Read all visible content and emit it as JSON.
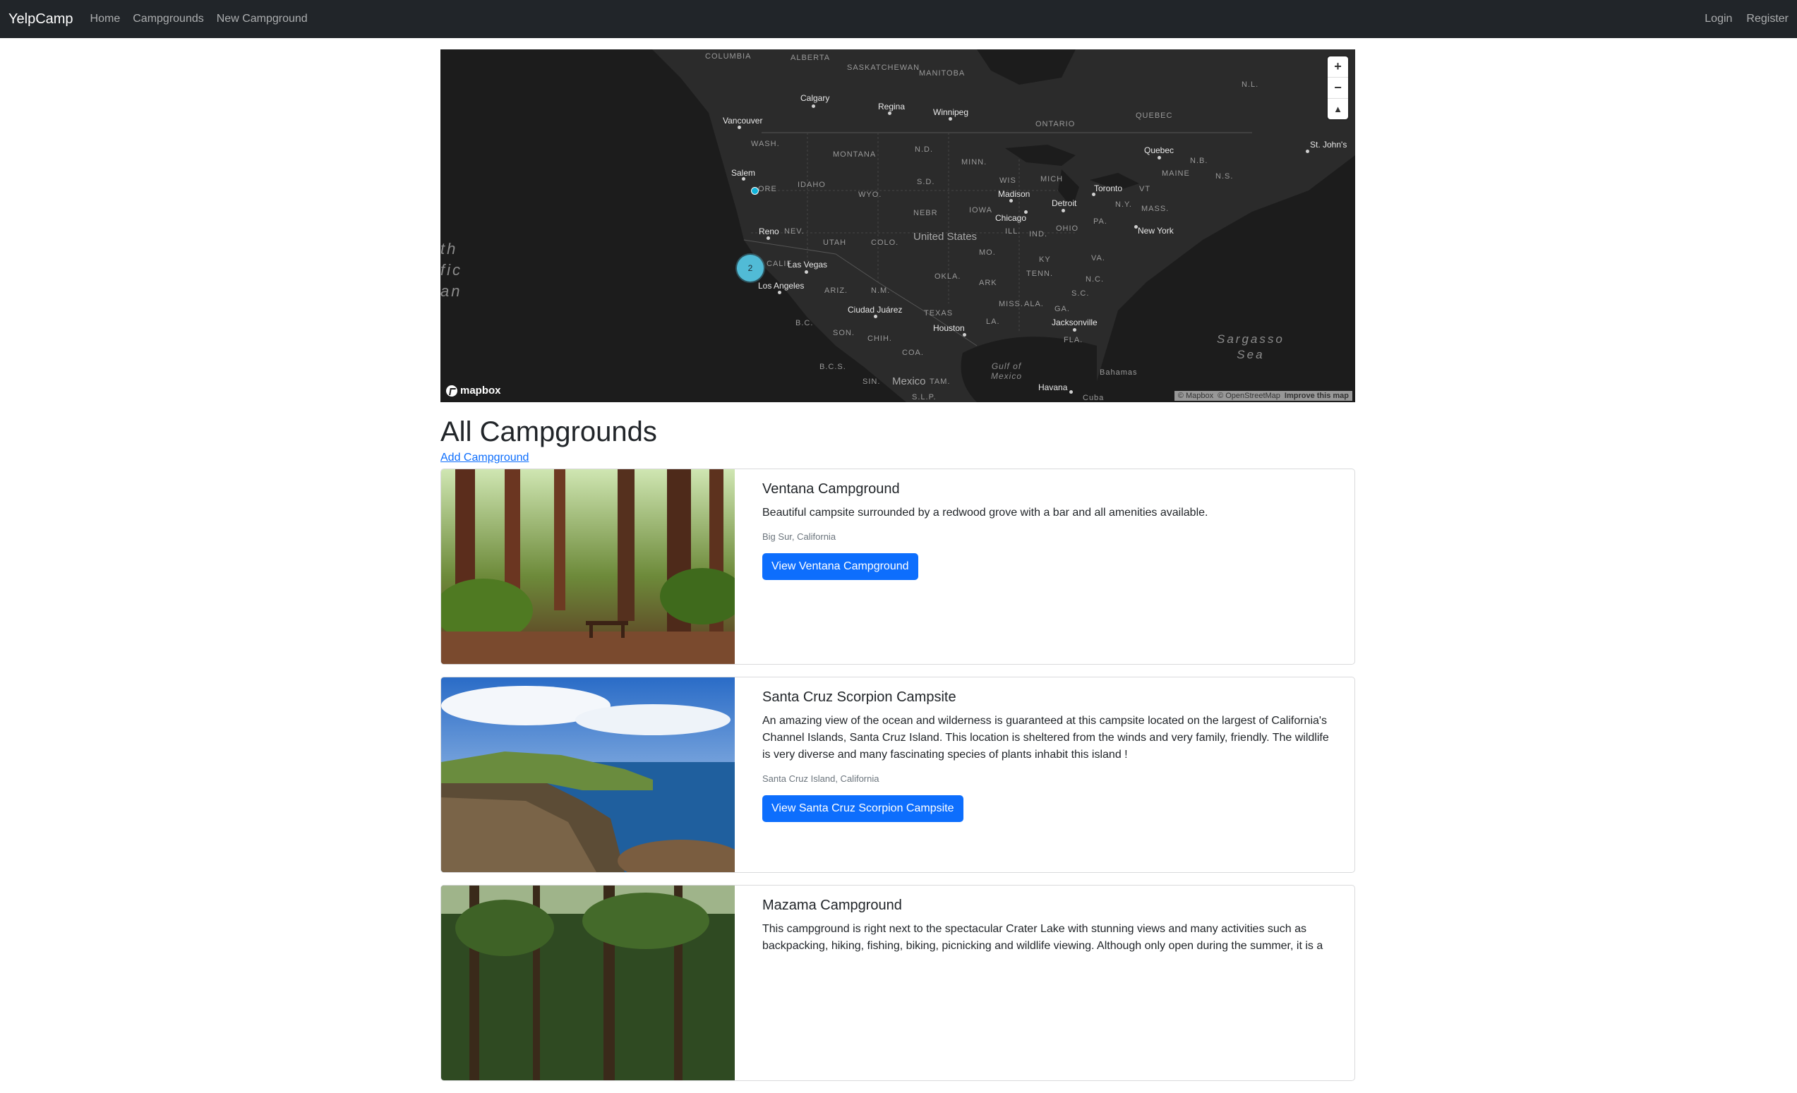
{
  "navbar": {
    "brand": "YelpCamp",
    "links": [
      "Home",
      "Campgrounds",
      "New Campground"
    ],
    "right_links": [
      "Login",
      "Register"
    ]
  },
  "map": {
    "states_regions": [
      "COLUMBIA",
      "ALBERTA",
      "SASKATCHEWAN",
      "MANITOBA",
      "WASH.",
      "MONTANA",
      "N.D.",
      "MINN.",
      "ONTARIO",
      "QUEBEC",
      "N.L.",
      "IDAHO",
      "WYO.",
      "S.D.",
      "WIS",
      "MICH",
      "ORE",
      "NEBR",
      "IOWA",
      "N.Y.",
      "MASS.",
      "N.B.",
      "MAINE",
      "N.S.",
      "VT",
      "NEV.",
      "UTAH",
      "COLO.",
      "ILL.",
      "IND.",
      "OHIO",
      "PA.",
      "CALIF",
      "ARIZ.",
      "N.M.",
      "OKLA.",
      "MO.",
      "KY",
      "VA.",
      "TENN.",
      "N.C.",
      "ARK",
      "MISS.",
      "ALA.",
      "GA.",
      "S.C.",
      "TEXAS",
      "LA.",
      "FLA.",
      "B.C.",
      "SON.",
      "CHIH.",
      "COA.",
      "B.C.S.",
      "SIN.",
      "TAM.",
      "S.L.P.",
      "Bahamas",
      "Cuba"
    ],
    "cities": [
      "Calgary",
      "Regina",
      "Winnipeg",
      "Vancouver",
      "Salem",
      "Quebec",
      "St. John's",
      "Madison",
      "Toronto",
      "Detroit",
      "Chicago",
      "New York",
      "Reno",
      "Las Vegas",
      "Los Angeles",
      "Ciudad Juárez",
      "Houston",
      "Jacksonville",
      "Havana"
    ],
    "country_labels": [
      "United States",
      "Mexico"
    ],
    "sea_labels": [
      "Sargasso\nSea",
      "Gulf of\nMexico",
      "th\nfic\nan"
    ],
    "cluster_count": "2",
    "zoom_in": "+",
    "zoom_out": "−",
    "compass": "▲",
    "logo_text": "mapbox",
    "attribution": [
      "© Mapbox",
      "© OpenStreetMap",
      "Improve this map"
    ]
  },
  "main": {
    "title": "All Campgrounds",
    "add_link": "Add Campground"
  },
  "campgrounds": [
    {
      "title": "Ventana Campground",
      "description": "Beautiful campsite surrounded by a redwood grove with a bar and all amenities available.",
      "location": "Big Sur, California",
      "button": "View Ventana Campground"
    },
    {
      "title": "Santa Cruz Scorpion Campsite",
      "description": "An amazing view of the ocean and wilderness is guaranteed at this campsite located on the largest of California's Channel Islands, Santa Cruz Island. This location is sheltered from the winds and very family, friendly. The wildlife is very diverse and many fascinating species of plants inhabit this island !",
      "location": "Santa Cruz Island, California",
      "button": "View Santa Cruz Scorpion Campsite"
    },
    {
      "title": "Mazama Campground",
      "description": "This campground is right next to the spectacular Crater Lake with stunning views and many activities such as backpacking, hiking, fishing, biking, picnicking and wildlife viewing. Although only open during the summer, it is a",
      "location": "",
      "button": ""
    }
  ]
}
